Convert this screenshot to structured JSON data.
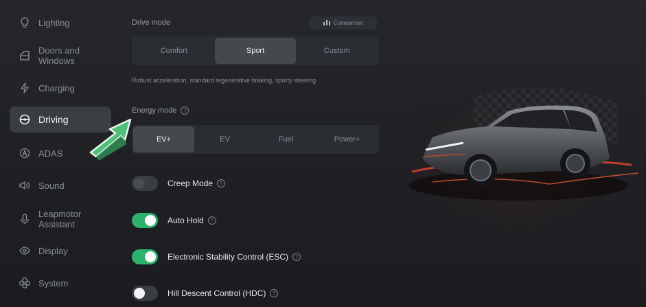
{
  "sidebar": {
    "items": [
      {
        "label": "Lighting",
        "icon": "bulb-icon",
        "active": false
      },
      {
        "label": "Doors and Windows",
        "icon": "car-door-icon",
        "active": false
      },
      {
        "label": "Charging",
        "icon": "bolt-icon",
        "active": false
      },
      {
        "label": "Driving",
        "icon": "steering-wheel-icon",
        "active": true
      },
      {
        "label": "ADAS",
        "icon": "adas-icon",
        "active": false
      },
      {
        "label": "Sound",
        "icon": "speaker-icon",
        "active": false
      },
      {
        "label": "Leapmotor Assistant",
        "icon": "microphone-icon",
        "active": false
      },
      {
        "label": "Display",
        "icon": "eye-icon",
        "active": false
      },
      {
        "label": "System",
        "icon": "system-icon",
        "active": false
      }
    ]
  },
  "drive_mode": {
    "label": "Drive mode",
    "comparison_label": "Comparison",
    "options": [
      "Comfort",
      "Sport",
      "Custom"
    ],
    "selected": "Sport",
    "description": "Robust acceleration, standard regenerative braking, sporty steering"
  },
  "energy_mode": {
    "label": "Energy mode",
    "options": [
      "EV+",
      "EV",
      "Fuel",
      "Power+"
    ],
    "selected": "EV+"
  },
  "toggles": [
    {
      "label": "Creep Mode",
      "on": false
    },
    {
      "label": "Auto Hold",
      "on": true
    },
    {
      "label": "Electronic Stability Control (ESC)",
      "on": true
    },
    {
      "label": "Hill Descent Control (HDC)",
      "on": false
    }
  ],
  "colors": {
    "accent_green": "#2fb26b",
    "arrow_green": "#4fbf7a",
    "active_bg": "#3a3d42",
    "car_glow": "#e0442a"
  }
}
